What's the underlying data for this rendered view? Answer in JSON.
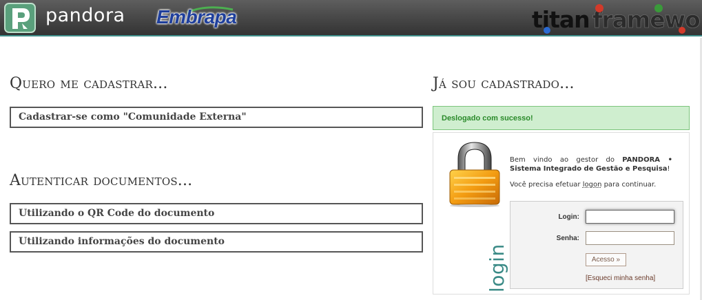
{
  "header": {
    "app_name": "pandora",
    "partner_name": "Embrapa",
    "framework_name": "titanframework"
  },
  "left": {
    "register_title": "Quero me cadastrar...",
    "register_external": "Cadastrar-se como \"Comunidade Externa\"",
    "auth_title": "Autenticar documentos...",
    "auth_qr": "Utilizando o QR Code do documento",
    "auth_info": "Utilizando informações do documento"
  },
  "right": {
    "title": "Já sou cadastrado...",
    "success_message": "Deslogado com sucesso!",
    "welcome_prefix": "Bem vindo ao gestor do ",
    "welcome_strong": "PANDORA • Sistema Integrado de Gestão e Pesquisa",
    "welcome_suffix": "!",
    "continue_prefix": "Você precisa efetuar ",
    "continue_link": "logon",
    "continue_suffix": " para continuar.",
    "vertical_label": "login",
    "form": {
      "login_label": "Login:",
      "login_value": "",
      "senha_label": "Senha:",
      "senha_value": "",
      "submit_label": "Acesso »",
      "forgot_label": "[Esqueci minha senha]"
    }
  },
  "colors": {
    "header_accent": "#3f8f8b",
    "success_bg": "#cfeecf",
    "success_text": "#2a8a2a",
    "embrapa_blue": "#1f3f9c",
    "lock_orange": "#f0a020"
  },
  "icons": {
    "pandora": "pandora-p-logo-icon",
    "lock": "padlock-icon"
  }
}
